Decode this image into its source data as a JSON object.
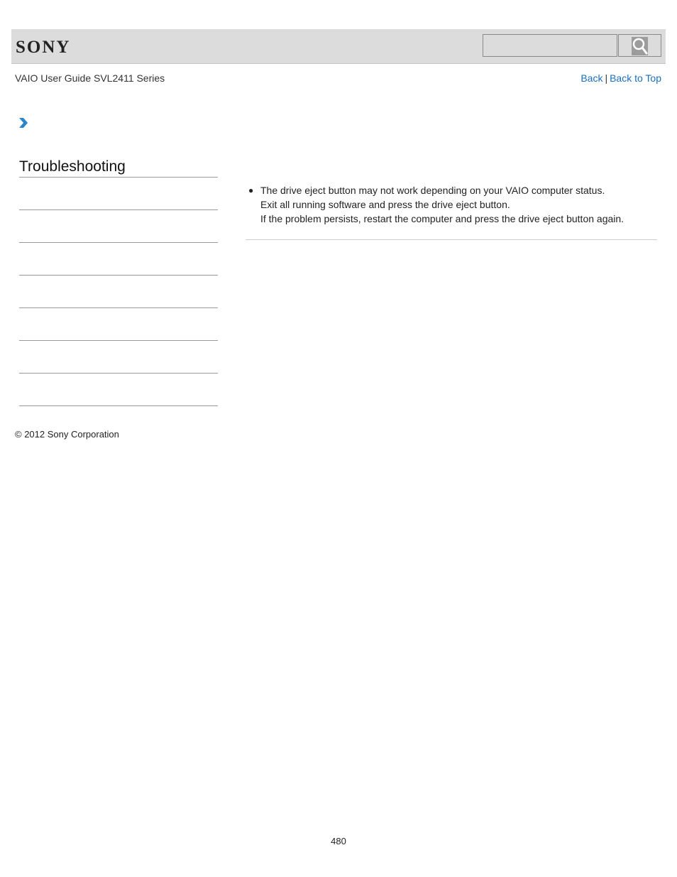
{
  "header": {
    "logo": "SONY",
    "search": {
      "value": "",
      "placeholder": "",
      "button_icon": "search-icon"
    }
  },
  "subheader": {
    "guide_title": "VAIO User Guide SVL2411 Series",
    "links": {
      "back": "Back",
      "separator": "|",
      "back_to_top": "Back to Top"
    }
  },
  "breadcrumb": {
    "icon": "chevron-right-icon",
    "accent_color": "#2e86c8"
  },
  "sidebar": {
    "title": "Troubleshooting",
    "items": [
      {
        "label": ""
      },
      {
        "label": ""
      },
      {
        "label": ""
      },
      {
        "label": ""
      },
      {
        "label": ""
      },
      {
        "label": ""
      },
      {
        "label": ""
      }
    ]
  },
  "content": {
    "bullets": [
      {
        "lines": [
          "The drive eject button may not work depending on your VAIO computer status.",
          "Exit all running software and press the drive eject button.",
          "If the problem persists, restart the computer and press the drive eject button again."
        ]
      }
    ]
  },
  "footer": {
    "copyright": "© 2012 Sony Corporation",
    "page_number": "480"
  },
  "colors": {
    "link": "#1a6ec0",
    "header_bg": "#dcdcdc"
  }
}
